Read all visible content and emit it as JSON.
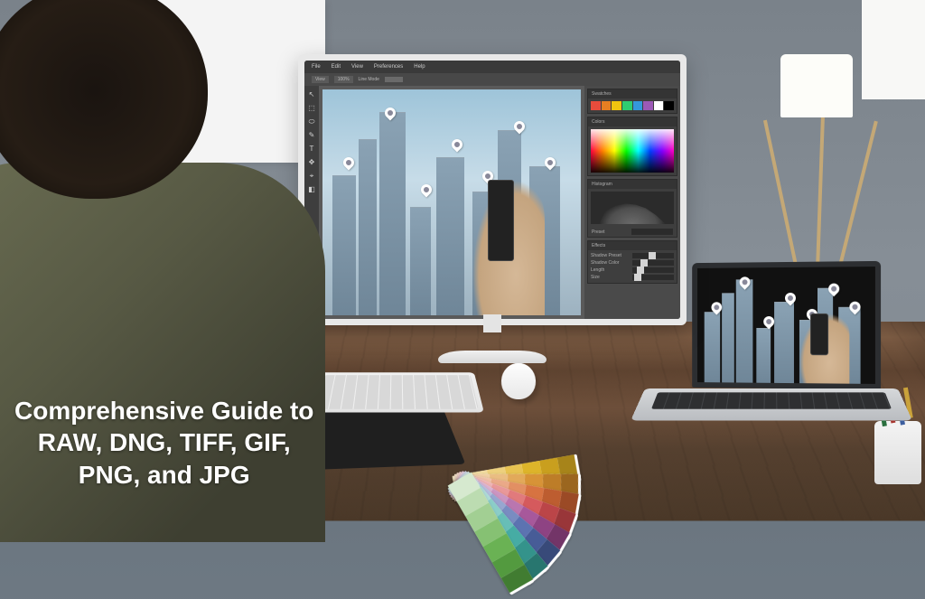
{
  "caption": {
    "line1": "Comprehensive Guide to",
    "line2": "RAW, DNG, TIFF, GIF,",
    "line3": "PNG, and JPG"
  },
  "editor": {
    "menubar": [
      "File",
      "Edit",
      "View",
      "Preferences",
      "Help"
    ],
    "toolbar": {
      "zoom": "100%",
      "mode_label": "Line Mode",
      "view_btn": "View"
    },
    "tools": [
      "↖",
      "⬚",
      "⬭",
      "✎",
      "T",
      "✥",
      "⌖",
      "◧"
    ],
    "panels": {
      "swatches": {
        "title": "Swatches"
      },
      "colors": {
        "title": "Colors"
      },
      "histogram": {
        "title": "Histogram",
        "preset_label": "Preset"
      },
      "effects": {
        "title": "Effects",
        "rows": [
          {
            "label": "Shadow Preset"
          },
          {
            "label": "Shadow Color"
          },
          {
            "label": "Length"
          },
          {
            "label": "Size"
          }
        ]
      }
    }
  },
  "swatch_fan": {
    "cards": [
      {
        "rot": -6,
        "chips": [
          "#f7e9c4",
          "#f2dca0",
          "#edd07d",
          "#e7c251",
          "#ddb42a",
          "#c99f1e",
          "#a7841a"
        ]
      },
      {
        "rot": 4,
        "chips": [
          "#f6e1c7",
          "#f0cfa4",
          "#eabd82",
          "#e2a95a",
          "#d79337",
          "#bd7d28",
          "#9b661f"
        ]
      },
      {
        "rot": 14,
        "chips": [
          "#f6d8ca",
          "#f0c1a9",
          "#eaa988",
          "#e28f63",
          "#d77341",
          "#bd5d30",
          "#9b4a26"
        ]
      },
      {
        "rot": 24,
        "chips": [
          "#f5cfd0",
          "#efb4b5",
          "#e99899",
          "#e17a7c",
          "#d55a5d",
          "#bb4548",
          "#993639"
        ]
      },
      {
        "rot": 34,
        "chips": [
          "#e9cfe1",
          "#dab2d1",
          "#cb95c1",
          "#ba76af",
          "#a7589b",
          "#8e4383",
          "#733568"
        ]
      },
      {
        "rot": 44,
        "chips": [
          "#cfd6ea",
          "#b3bedd",
          "#97a6d0",
          "#798cc1",
          "#5c73b1",
          "#475c97",
          "#384a79"
        ]
      },
      {
        "rot": 54,
        "chips": [
          "#cfe6e4",
          "#addad6",
          "#8bcdc8",
          "#67beb7",
          "#46aca4",
          "#34938b",
          "#28766f"
        ]
      },
      {
        "rot": 64,
        "chips": [
          "#d6e9cf",
          "#bcdcb1",
          "#a2cf93",
          "#86c173",
          "#6ab254",
          "#539a3f",
          "#417c31"
        ]
      }
    ]
  }
}
